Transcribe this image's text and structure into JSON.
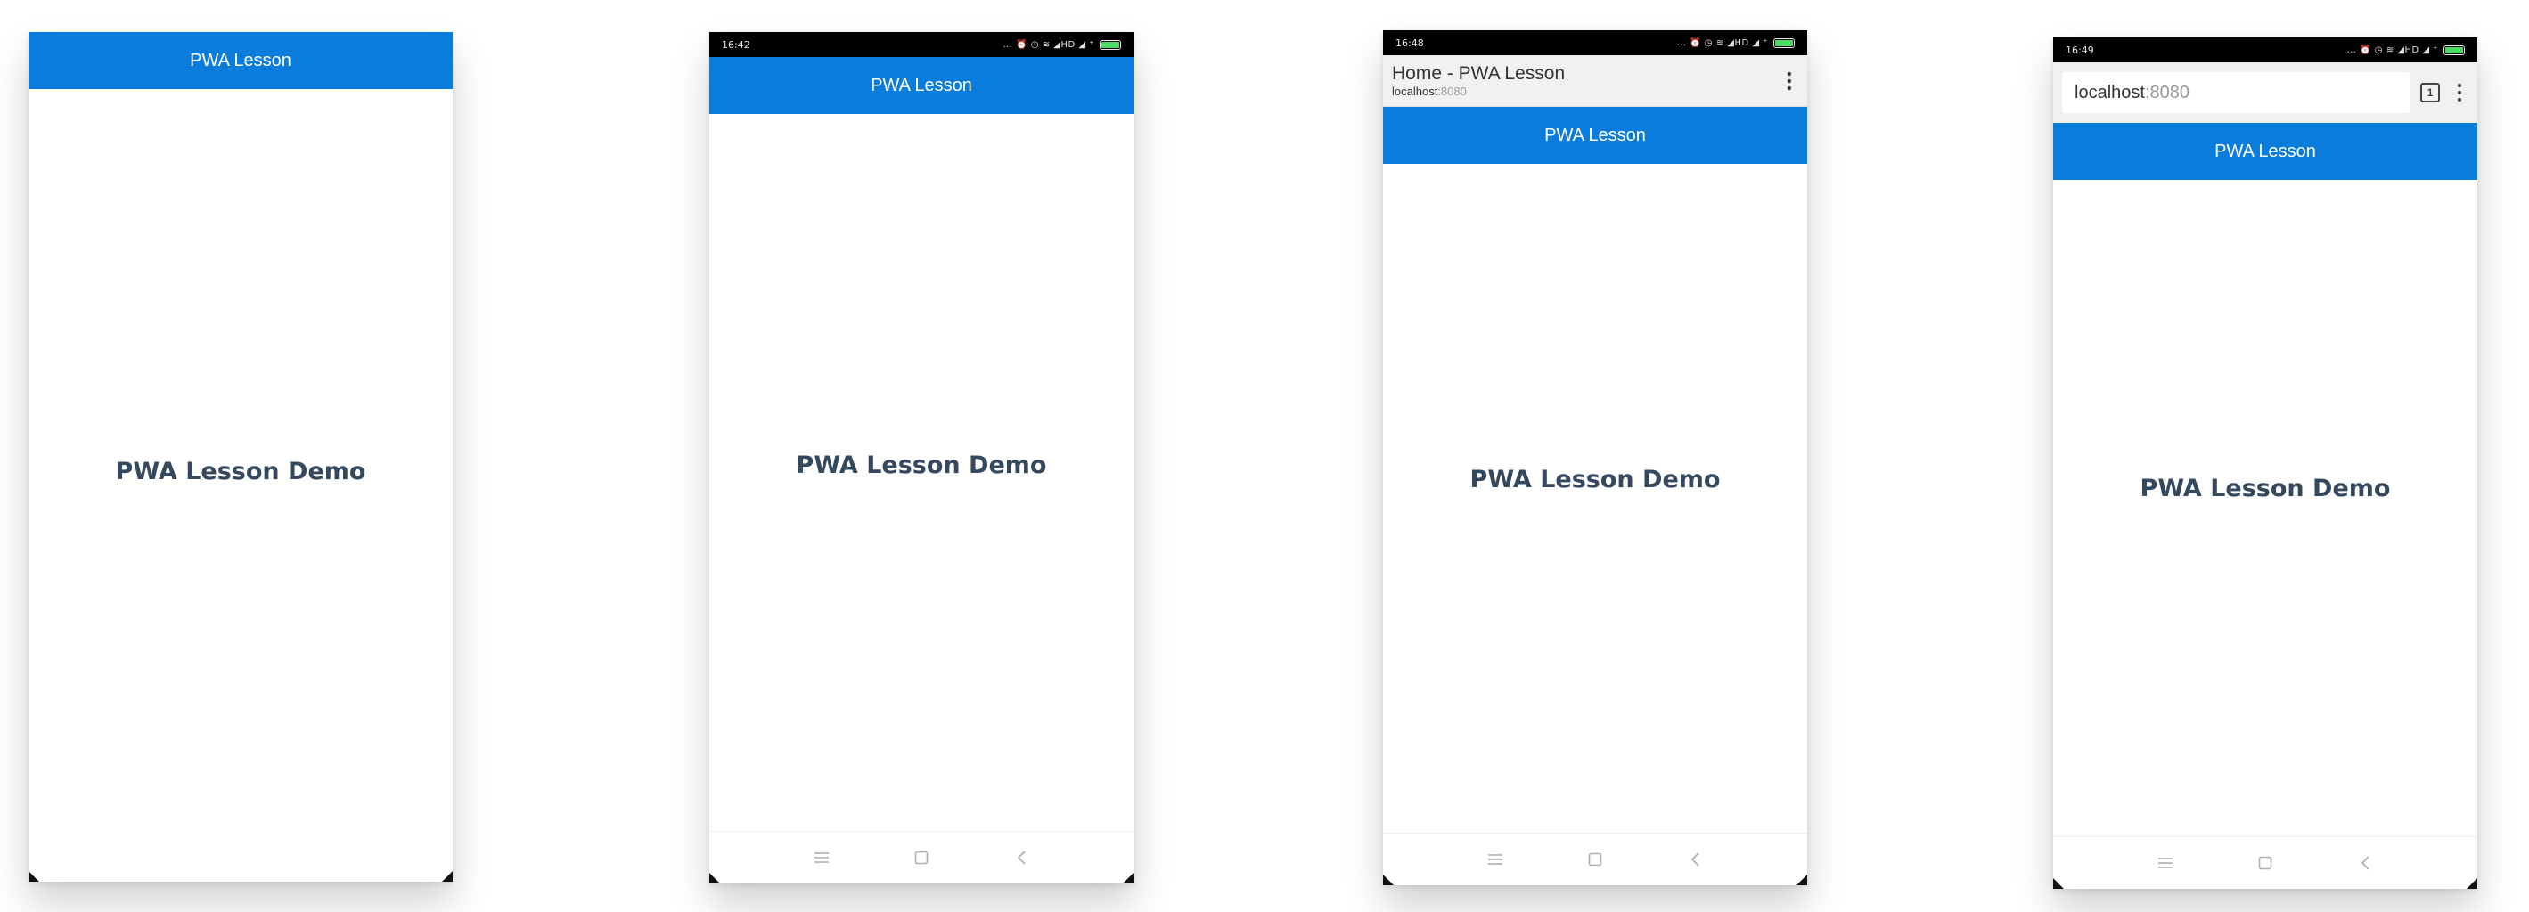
{
  "colors": {
    "header_blue": "#0a7ddc",
    "title_text": "#35495e",
    "status_bar": "#000000",
    "battery": "#4cd964"
  },
  "phones": [
    {
      "header_title": "PWA Lesson",
      "demo_title": "PWA Lesson Demo"
    },
    {
      "status_time": "16:42",
      "status_icons": "... ⏰ ◷ ≋ ◢HD ◢ ⁺",
      "header_title": "PWA Lesson",
      "demo_title": "PWA Lesson Demo",
      "nav_icons": [
        "menu-icon",
        "home-square-icon",
        "back-chevron-icon"
      ]
    },
    {
      "status_time": "16:48",
      "status_icons": "... ⏰ ◷ ≋ ◢HD ◢ ⁺",
      "tab_title": "Home - PWA Lesson",
      "tab_host": "localhost",
      "tab_port": ":8080",
      "header_title": "PWA Lesson",
      "demo_title": "PWA Lesson Demo",
      "nav_icons": [
        "menu-icon",
        "home-square-icon",
        "back-chevron-icon"
      ]
    },
    {
      "status_time": "16:49",
      "status_icons": "... ⏰ ◷ ≋ ◢HD ◢ ⁺",
      "url_host": "localhost",
      "url_port": ":8080",
      "tab_count": "1",
      "header_title": "PWA Lesson",
      "demo_title": "PWA Lesson Demo",
      "nav_icons": [
        "menu-icon",
        "home-square-icon",
        "back-chevron-icon"
      ]
    }
  ]
}
